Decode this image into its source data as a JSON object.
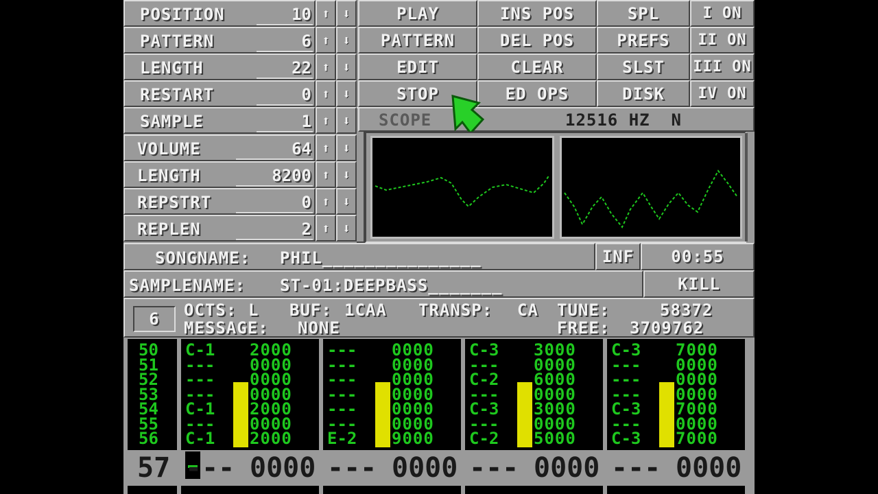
{
  "left_rows": [
    {
      "label": "POSITION",
      "value": "10"
    },
    {
      "label": "PATTERN",
      "value": "6"
    },
    {
      "label": "LENGTH",
      "value": "22"
    },
    {
      "label": "RESTART",
      "value": "0"
    },
    {
      "label": "SAMPLE",
      "value": "1"
    },
    {
      "label": "VOLUME",
      "value": "64"
    },
    {
      "label": "LENGTH",
      "value": "8200"
    },
    {
      "label": "REPSTRT",
      "value": "0"
    },
    {
      "label": "REPLEN",
      "value": "2"
    }
  ],
  "arrows": {
    "up": "⬆",
    "down": "⬇"
  },
  "buttons": {
    "play": "PLAY",
    "pattern": "PATTERN",
    "edit": "EDIT",
    "stop": "STOP",
    "ins_pos": "INS POS",
    "del_pos": "DEL POS",
    "clear": "CLEAR",
    "ed_ops": "ED OPS",
    "spl": "SPL",
    "prefs": "PREFS",
    "slst": "SLST",
    "disk": "DISK"
  },
  "channels": [
    "I ON",
    "II ON",
    "III ON",
    "IV ON"
  ],
  "scope": {
    "label": "SCOPE",
    "freq": "12516 HZ  N"
  },
  "songname": {
    "label": "SONGNAME:",
    "value": "PHIL_______________"
  },
  "inf": "INF",
  "time": "00:55",
  "samplename": {
    "label": "SAMPLENAME:",
    "value": "ST-01:DEEPBASS_______"
  },
  "kill": "KILL",
  "status": {
    "pattern_num": "6",
    "octs_label": "OCTS:",
    "octs": "L",
    "buf_label": "BUF:",
    "buf": "1CAA",
    "transp_label": "TRANSP:",
    "transp": "CA",
    "tune_label": "TUNE:",
    "tune": "58372",
    "message_label": "MESSAGE:",
    "message": "NONE",
    "free_label": "FREE:",
    "free": "3709762"
  },
  "tracker": {
    "row_numbers": [
      "50",
      "51",
      "52",
      "53",
      "54",
      "55",
      "56"
    ],
    "tracks": [
      {
        "notes": [
          "C-1",
          "---",
          "---",
          "---",
          "C-1",
          "---",
          "C-1"
        ],
        "cmds": [
          "2000",
          "0000",
          "0000",
          "0000",
          "2000",
          "0000",
          "2000"
        ]
      },
      {
        "notes": [
          "---",
          "---",
          "---",
          "---",
          "---",
          "---",
          "E-2"
        ],
        "cmds": [
          "0000",
          "0000",
          "0000",
          "0000",
          "0000",
          "0000",
          "9000"
        ]
      },
      {
        "notes": [
          "C-3",
          "---",
          "C-2",
          "---",
          "C-3",
          "---",
          "C-2"
        ],
        "cmds": [
          "3000",
          "0000",
          "6000",
          "0000",
          "3000",
          "0000",
          "5000"
        ]
      },
      {
        "notes": [
          "C-3",
          "---",
          "---",
          "---",
          "C-3",
          "---",
          "C-3"
        ],
        "cmds": [
          "7000",
          "0000",
          "0000",
          "0000",
          "7000",
          "0000",
          "7000"
        ]
      }
    ],
    "vu_levels": [
      0.7,
      0.7,
      0.7,
      0.7
    ],
    "current_row": "57",
    "current": [
      {
        "note": "---",
        "cmd": "0000"
      },
      {
        "note": "---",
        "cmd": "0000"
      },
      {
        "note": "---",
        "cmd": "0000"
      },
      {
        "note": "---",
        "cmd": "0000"
      }
    ]
  },
  "colors": {
    "panel": "#9a9a9a",
    "green": "#1ec81e",
    "vu": "#e0e000",
    "black": "#000000"
  }
}
